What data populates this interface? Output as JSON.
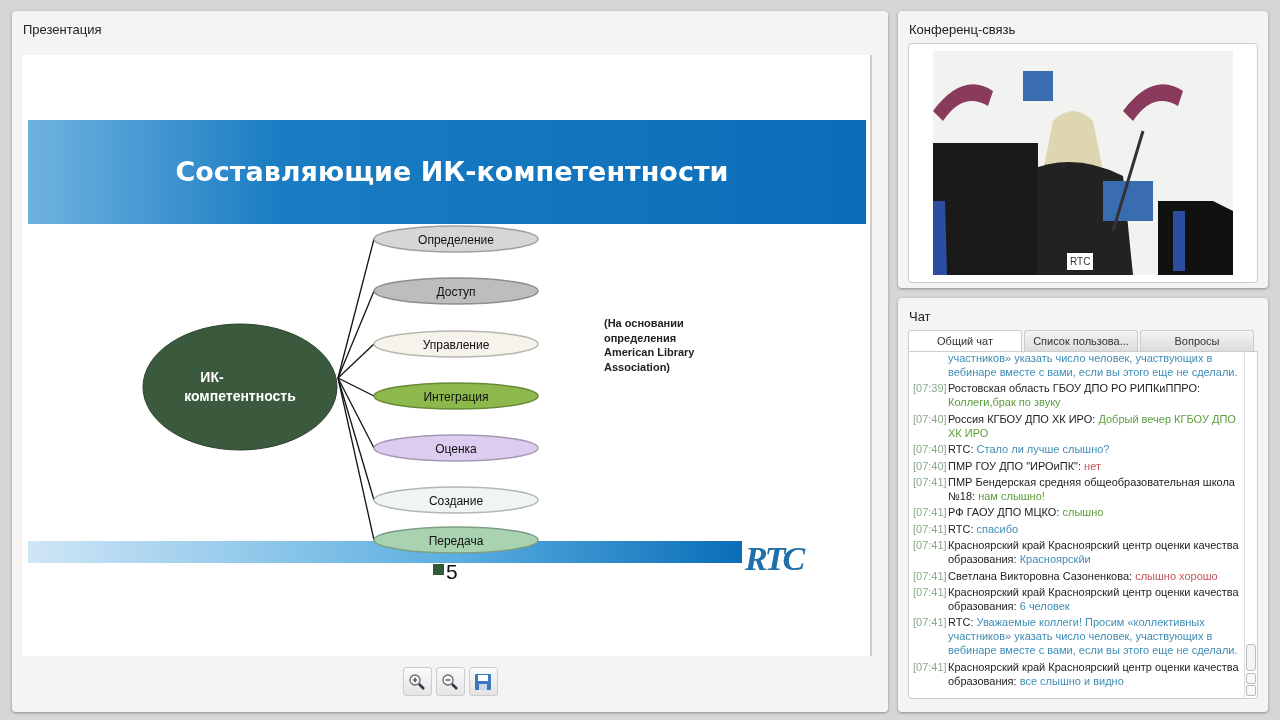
{
  "presentation": {
    "title": "Презентация",
    "slide": {
      "title": "Составляющие ИК-компетентности",
      "center_lines": [
        "ИК-",
        "компетентность"
      ],
      "nodes": [
        {
          "label": "Определение",
          "color": "#d6d6d6"
        },
        {
          "label": "Доступ",
          "color": "#bdbdbd"
        },
        {
          "label": "Управление",
          "color": "#f6f3ec"
        },
        {
          "label": "Интеграция",
          "color": "#8db84c"
        },
        {
          "label": "Оценка",
          "color": "#dccdf0"
        },
        {
          "label": "Создание",
          "color": "#eef5f2"
        },
        {
          "label": "Передача",
          "color": "#a9d3b0"
        }
      ],
      "note_lines": [
        "(На основании",
        "определения",
        "American Library",
        "Association)"
      ],
      "logo_text": "RTC",
      "page_number": "5"
    },
    "toolbar": [
      {
        "kind": "zoom-in"
      },
      {
        "kind": "zoom-out"
      },
      {
        "kind": "save"
      }
    ]
  },
  "conference": {
    "title": "Конференц-связь",
    "video": {
      "kind": "picture",
      "caption": "RTC"
    }
  },
  "chat": {
    "title": "Чат",
    "tabs": [
      {
        "label": "Общий чат",
        "selected": true
      },
      {
        "label": "Список пользова...",
        "selected": false
      },
      {
        "label": "Вопросы",
        "selected": false
      }
    ],
    "messages": [
      {
        "text": "участников» указать число человек, участвующих в вебинаре вместе с вами, если вы этого еще не сделали.",
        "color": "#3f8db5"
      },
      {
        "time": "[07:39]",
        "author": "Ростовская область ГБОУ ДПО РО РИПКиППРО:",
        "text": "Коллеги,брак по звуку",
        "color": "#5b9e3c"
      },
      {
        "time": "[07:40]",
        "author": "Россия КГБОУ ДПО ХК ИРО:",
        "text": "Добрый вечер КГБОУ ДПО ХК ИРО",
        "color": "#5b9e3c"
      },
      {
        "time": "[07:40]",
        "author": "RTC:",
        "text": "Стало ли лучше слышно?",
        "color": "#3f8db5"
      },
      {
        "time": "[07:40]",
        "author": "ПМР ГОУ ДПО \"ИРОиПК\":",
        "text": "нет",
        "color": "#c4545a"
      },
      {
        "time": "[07:41]",
        "author": "ПМР Бендерская средняя общеобразовательная школа №18:",
        "text": "нам слышно!",
        "color": "#5b9e3c"
      },
      {
        "time": "[07:41]",
        "author": "РФ ГАОУ ДПО МЦКО:",
        "text": "слышно",
        "color": "#5b9e3c"
      },
      {
        "time": "[07:41]",
        "author": "RTC:",
        "text": "спасибо",
        "color": "#3f8db5"
      },
      {
        "time": "[07:41]",
        "author": "Красноярский край Красноярский центр оценки качества образования:",
        "text": "Красноярскйи",
        "color": "#3f8db5"
      },
      {
        "time": "[07:41]",
        "author": "Светлана Викторовна Сазоненкова:",
        "text": "слышно хорошо",
        "color": "#c4545a"
      },
      {
        "time": "[07:41]",
        "author": "Красноярский край Красноярский центр оценки качества образования:",
        "text": "6 человек",
        "color": "#3f8db5"
      },
      {
        "time": "[07:41]",
        "author": "RTC:",
        "text": "Уважаемые коллеги! Просим «коллективных участников» указать число человек, участвующих в вебинаре вместе с вами, если вы этого еще не сделали.",
        "color": "#3f8db5"
      },
      {
        "time": "[07:41]",
        "author": "Красноярский край Красноярский центр оценки качества образования:",
        "text": "все слышно и видно",
        "color": "#3f8db5"
      }
    ]
  }
}
